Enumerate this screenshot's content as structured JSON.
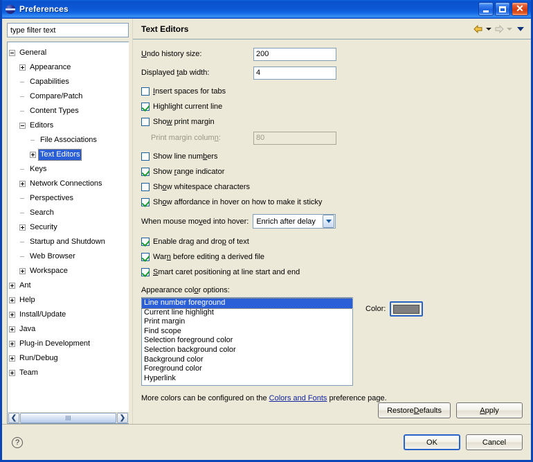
{
  "window": {
    "title": "Preferences",
    "icon": "eclipse-globe-icon",
    "minimize": "minimize-button",
    "maximize": "maximize-button",
    "close": "close-button"
  },
  "filter": {
    "value": "type filter text",
    "placeholder": "type filter text"
  },
  "tree": {
    "items": [
      {
        "label": "General",
        "depth": 0,
        "expander": "minus",
        "selected": false
      },
      {
        "label": "Appearance",
        "depth": 1,
        "expander": "plus",
        "selected": false
      },
      {
        "label": "Capabilities",
        "depth": 1,
        "expander": "none",
        "selected": false
      },
      {
        "label": "Compare/Patch",
        "depth": 1,
        "expander": "none",
        "selected": false
      },
      {
        "label": "Content Types",
        "depth": 1,
        "expander": "none",
        "selected": false
      },
      {
        "label": "Editors",
        "depth": 1,
        "expander": "minus",
        "selected": false
      },
      {
        "label": "File Associations",
        "depth": 2,
        "expander": "none",
        "selected": false
      },
      {
        "label": "Text Editors",
        "depth": 2,
        "expander": "plus",
        "selected": true
      },
      {
        "label": "Keys",
        "depth": 1,
        "expander": "none",
        "selected": false
      },
      {
        "label": "Network Connections",
        "depth": 1,
        "expander": "plus",
        "selected": false
      },
      {
        "label": "Perspectives",
        "depth": 1,
        "expander": "none",
        "selected": false
      },
      {
        "label": "Search",
        "depth": 1,
        "expander": "none",
        "selected": false
      },
      {
        "label": "Security",
        "depth": 1,
        "expander": "plus",
        "selected": false
      },
      {
        "label": "Startup and Shutdown",
        "depth": 1,
        "expander": "none",
        "selected": false
      },
      {
        "label": "Web Browser",
        "depth": 1,
        "expander": "none",
        "selected": false
      },
      {
        "label": "Workspace",
        "depth": 1,
        "expander": "plus",
        "selected": false
      },
      {
        "label": "Ant",
        "depth": 0,
        "expander": "plus",
        "selected": false
      },
      {
        "label": "Help",
        "depth": 0,
        "expander": "plus",
        "selected": false
      },
      {
        "label": "Install/Update",
        "depth": 0,
        "expander": "plus",
        "selected": false
      },
      {
        "label": "Java",
        "depth": 0,
        "expander": "plus",
        "selected": false
      },
      {
        "label": "Plug-in Development",
        "depth": 0,
        "expander": "plus",
        "selected": false
      },
      {
        "label": "Run/Debug",
        "depth": 0,
        "expander": "plus",
        "selected": false
      },
      {
        "label": "Team",
        "depth": 0,
        "expander": "plus",
        "selected": false
      }
    ]
  },
  "page": {
    "title": "Text Editors",
    "nav": {
      "back": "back-arrow",
      "forward": "forward-arrow",
      "menu": "dropdown-chevron"
    },
    "fields": [
      {
        "label": "Undo history size:",
        "value": "200",
        "disabled": false
      },
      {
        "label": "Displayed tab width:",
        "value": "4",
        "disabled": false
      }
    ],
    "print_margin_field": {
      "label": "Print margin column:",
      "value": "80",
      "disabled": true
    },
    "checkboxes_top": [
      {
        "label": "Insert spaces for tabs",
        "checked": false
      },
      {
        "label": "Highlight current line",
        "checked": true
      },
      {
        "label": "Show print margin",
        "checked": false
      }
    ],
    "checkboxes_mid": [
      {
        "label": "Show line numbers",
        "checked": false
      },
      {
        "label": "Show range indicator",
        "checked": true
      },
      {
        "label": "Show whitespace characters",
        "checked": false
      },
      {
        "label": "Show affordance in hover on how to make it sticky",
        "checked": true
      }
    ],
    "hover": {
      "label": "When mouse moved into hover:",
      "value": "Enrich after delay"
    },
    "checkboxes_bottom": [
      {
        "label": "Enable drag and drop of text",
        "checked": true
      },
      {
        "label": "Warn before editing a derived file",
        "checked": true
      },
      {
        "label": "Smart caret positioning at line start and end",
        "checked": true
      }
    ],
    "appearance_label": "Appearance color options:",
    "color_options": [
      "Line number foreground",
      "Current line highlight",
      "Print margin",
      "Find scope",
      "Selection foreground color",
      "Selection background color",
      "Background color",
      "Foreground color",
      "Hyperlink"
    ],
    "color_selected_index": 0,
    "color_picker": {
      "label": "Color:",
      "swatch_hex": "#7f7f7f"
    },
    "more_colors": {
      "prefix": "More colors can be configured on the ",
      "link": "Colors and Fonts",
      "suffix": " preference page."
    },
    "restore_defaults": "Restore Defaults",
    "apply": "Apply"
  },
  "footer": {
    "help": "?",
    "ok": "OK",
    "cancel": "Cancel"
  },
  "colors": {
    "titlebar_blue": "#0b57d0",
    "dialog_bg": "#ece9d8",
    "selection_blue": "#2a5fd7",
    "link_blue": "#12239e",
    "check_green": "#1a9a2e"
  }
}
